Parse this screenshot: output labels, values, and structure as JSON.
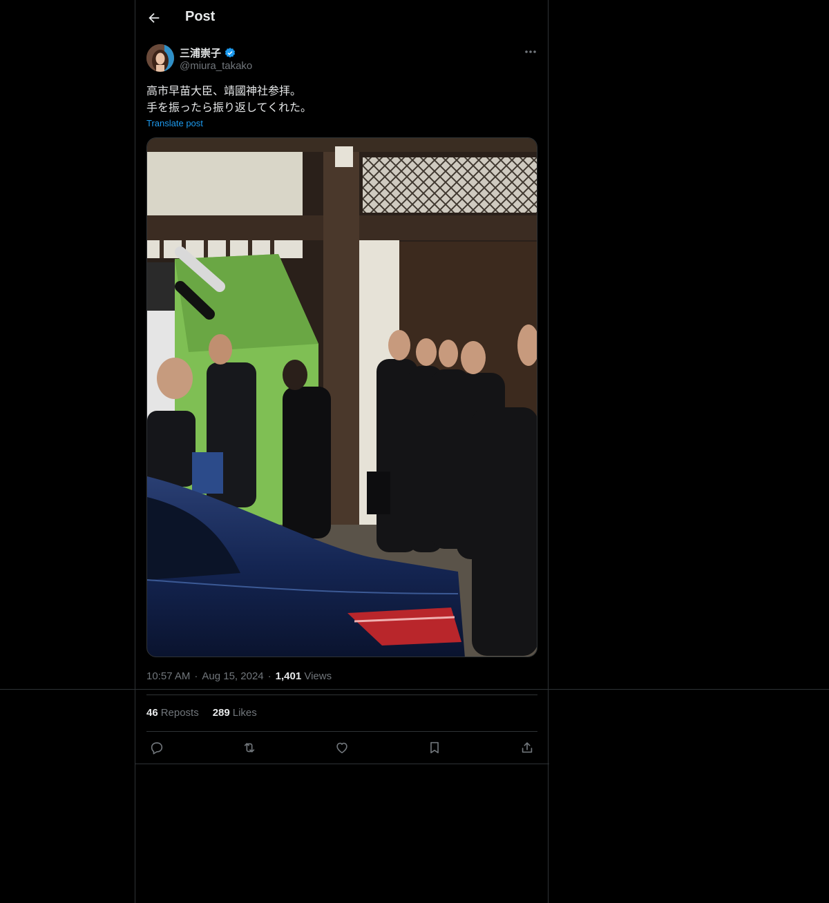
{
  "header": {
    "title": "Post"
  },
  "post": {
    "author": {
      "name": "三浦崇子",
      "handle": "@miura_takako",
      "verified": true
    },
    "text_lines": [
      "高市早苗大臣、靖國神社参拝。",
      "手を振ったら振り返してくれた。"
    ],
    "translate_label": "Translate post",
    "time": "10:57 AM",
    "date": "Aug 15, 2024",
    "views_count": "1,401",
    "views_label": "Views",
    "reposts_count": "46",
    "reposts_label": "Reposts",
    "likes_count": "289",
    "likes_label": "Likes",
    "dot": "·"
  },
  "colors": {
    "accent": "#1d9bf0",
    "muted": "#71767b",
    "text": "#e7e9ea",
    "border": "#2f3336",
    "background": "#000000"
  },
  "icons": [
    "back-arrow-icon",
    "verified-badge-icon",
    "more-icon",
    "reply-icon",
    "repost-icon",
    "like-icon",
    "bookmark-icon",
    "share-icon"
  ]
}
